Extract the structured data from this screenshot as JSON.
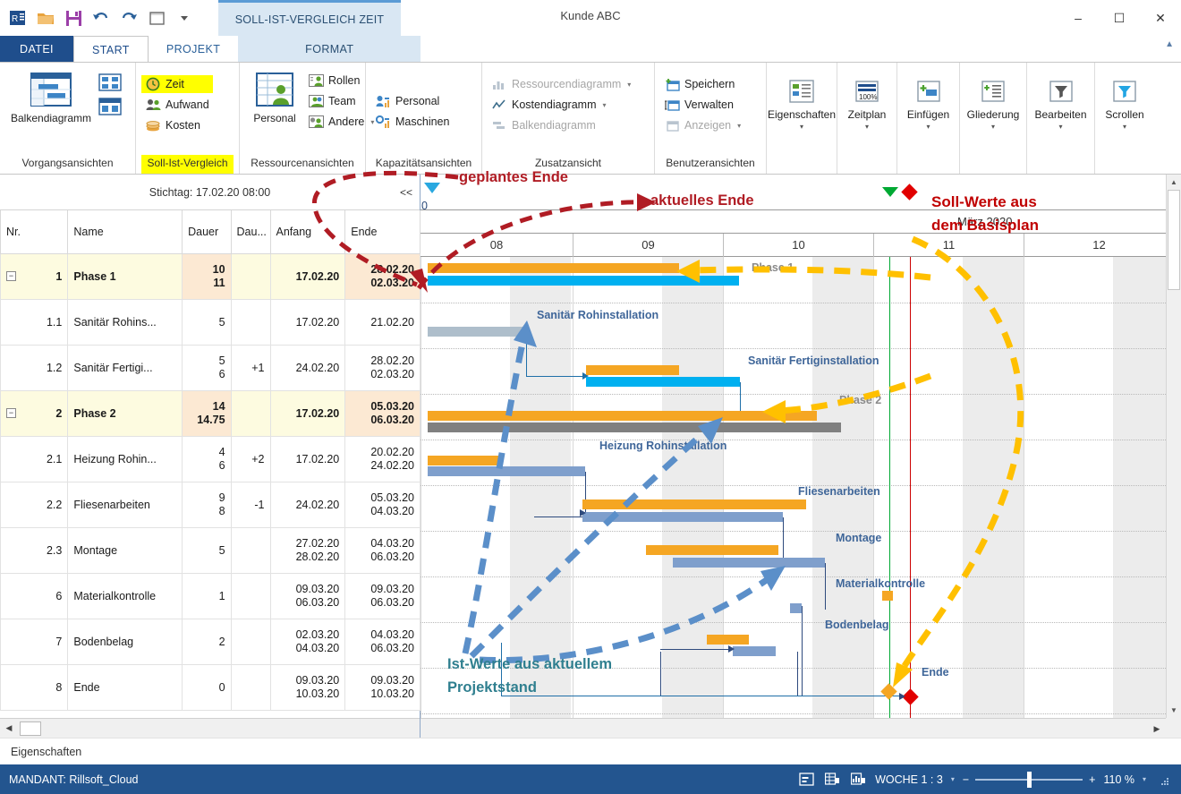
{
  "window": {
    "title": "Kunde ABC",
    "context_tab_banner": "SOLL-IST-VERGLEICH ZEIT",
    "minimize": "–",
    "maximize": "☐",
    "close": "✕",
    "qat_icons": [
      "app-logo-icon",
      "open-folder-icon",
      "save-icon",
      "undo-icon",
      "redo-icon",
      "new-window-icon",
      "customize-qat-icon"
    ]
  },
  "tabs": [
    {
      "label": "DATEI",
      "name": "tab-datei"
    },
    {
      "label": "START",
      "name": "tab-start"
    },
    {
      "label": "PROJEKT",
      "name": "tab-projekt"
    },
    {
      "label": "FORMAT",
      "name": "tab-format"
    }
  ],
  "ribbon": {
    "collapse_caret": "▲",
    "groups": [
      {
        "label": "Vorgangsansichten",
        "highlight": false,
        "big": {
          "label": "Balkendiagramm",
          "icon": "gantt-chart-icon"
        },
        "stack": [
          "network-diagram-icon",
          "table-view-icon"
        ]
      },
      {
        "label": "Soll-Ist-Vergleich",
        "highlight": true,
        "items": [
          {
            "label": "Zeit",
            "icon": "clock-icon",
            "highlight": true,
            "dim": false
          },
          {
            "label": "Aufwand",
            "icon": "people-icon",
            "highlight": false,
            "dim": false
          },
          {
            "label": "Kosten",
            "icon": "coins-icon",
            "highlight": false,
            "dim": false
          }
        ]
      },
      {
        "label": "Ressourcenansichten",
        "highlight": false,
        "big": {
          "label": "Personal",
          "icon": "resource-table-icon"
        },
        "items": [
          {
            "label": "Rollen",
            "icon": "roles-icon",
            "dim": false
          },
          {
            "label": "Team",
            "icon": "team-icon",
            "dim": false
          },
          {
            "label": "Andere",
            "icon": "other-icon",
            "dim": false,
            "caret": "▾"
          }
        ]
      },
      {
        "label": "Kapazitätsansichten",
        "highlight": false,
        "items": [
          {
            "label": "Personal",
            "icon": "staff-bars-icon",
            "dim": false
          },
          {
            "label": "Maschinen",
            "icon": "machine-bars-icon",
            "dim": false
          }
        ]
      },
      {
        "label": "Zusatzansicht",
        "highlight": false,
        "items": [
          {
            "label": "Ressourcendiagramm",
            "icon": "bar-chart-icon",
            "dim": true,
            "caret": "▾"
          },
          {
            "label": "Kostendiagramm",
            "icon": "line-chart-icon",
            "dim": false,
            "caret": "▾"
          },
          {
            "label": "Balkendiagramm",
            "icon": "gantt-small-icon",
            "dim": true
          }
        ]
      },
      {
        "label": "Benutzeransichten",
        "highlight": false,
        "items": [
          {
            "label": "Speichern",
            "icon": "save-view-icon",
            "dim": false
          },
          {
            "label": "Verwalten",
            "icon": "manage-view-icon",
            "dim": false
          },
          {
            "label": "Anzeigen",
            "icon": "show-view-icon",
            "dim": true,
            "caret": "▾"
          }
        ]
      }
    ],
    "right_buttons": [
      {
        "label": "Eigenschaften",
        "icon": "properties-icon",
        "arrow": "▾"
      },
      {
        "label": "Zeitplan",
        "icon": "schedule-100-icon",
        "arrow": "▾"
      },
      {
        "label": "Einfügen",
        "icon": "insert-icon",
        "arrow": "▾"
      },
      {
        "label": "Gliederung",
        "icon": "outline-icon",
        "arrow": "▾"
      },
      {
        "label": "Bearbeiten",
        "icon": "filter-icon",
        "arrow": "▾"
      },
      {
        "label": "Scrollen",
        "icon": "scroll-filter-icon",
        "arrow": "▾"
      }
    ]
  },
  "table": {
    "stichtag": "Stichtag: 17.02.20 08:00",
    "collapse_label": "<<",
    "columns": [
      "Nr.",
      "Name",
      "Dauer",
      "Dau...",
      "Anfang",
      "Ende"
    ],
    "rows": [
      {
        "nr": "1",
        "name": "Phase 1",
        "dauer": "10\n11",
        "dauer_diff": "",
        "anfang": "17.02.20",
        "ende": "28.02.20\n02.03.20",
        "phase": true,
        "expander": "−"
      },
      {
        "nr": "1.1",
        "name": "Sanitär Rohins...",
        "dauer": "5",
        "dauer_diff": "",
        "anfang": "17.02.20",
        "ende": "21.02.20",
        "phase": false,
        "expander": ""
      },
      {
        "nr": "1.2",
        "name": "Sanitär Fertigi...",
        "dauer": "5\n6",
        "dauer_diff": "+1",
        "anfang": "24.02.20",
        "ende": "28.02.20\n02.03.20",
        "phase": false,
        "expander": ""
      },
      {
        "nr": "2",
        "name": "Phase 2",
        "dauer": "14\n14.75",
        "dauer_diff": "",
        "anfang": "17.02.20",
        "ende": "05.03.20\n06.03.20",
        "phase": true,
        "expander": "−"
      },
      {
        "nr": "2.1",
        "name": "Heizung Rohin...",
        "dauer": "4\n6",
        "dauer_diff": "+2",
        "anfang": "17.02.20",
        "ende": "20.02.20\n24.02.20",
        "phase": false,
        "expander": ""
      },
      {
        "nr": "2.2",
        "name": "Fliesenarbeiten",
        "dauer": "9\n8",
        "dauer_diff": "-1",
        "anfang": "24.02.20",
        "ende": "05.03.20\n04.03.20",
        "phase": false,
        "expander": ""
      },
      {
        "nr": "2.3",
        "name": "Montage",
        "dauer": "5",
        "dauer_diff": "",
        "anfang": "27.02.20\n28.02.20",
        "ende": "04.03.20\n06.03.20",
        "phase": false,
        "expander": ""
      },
      {
        "nr": "6",
        "name": "Materialkontrolle",
        "dauer": "1",
        "dauer_diff": "",
        "anfang": "09.03.20\n06.03.20",
        "ende": "09.03.20\n06.03.20",
        "phase": false,
        "expander": ""
      },
      {
        "nr": "7",
        "name": "Bodenbelag",
        "dauer": "2",
        "dauer_diff": "",
        "anfang": "02.03.20\n04.03.20",
        "ende": "04.03.20\n06.03.20",
        "phase": false,
        "expander": ""
      },
      {
        "nr": "8",
        "name": "Ende",
        "dauer": "0",
        "dauer_diff": "",
        "anfang": "09.03.20\n10.03.20",
        "ende": "09.03.20\n10.03.20",
        "phase": false,
        "expander": ""
      }
    ]
  },
  "gantt": {
    "month_label": "März 2020",
    "week_ticks": [
      "08",
      "09",
      "10",
      "11",
      "12"
    ],
    "edge_tick": "0",
    "bar_labels": [
      "Phase 1",
      "Sanitär Rohinstallation",
      "Sanitär Fertiginstallation",
      "Phase 2",
      "Heizung Rohinstallation",
      "Fliesenarbeiten",
      "Montage",
      "Materialkontrolle",
      "Bodenbelag",
      "Ende"
    ],
    "markers": {
      "green_triangle": "today-marker-green",
      "red_diamond": "deadline-marker-red",
      "blue_triangle": "status-date-marker-blue"
    }
  },
  "annotations": [
    {
      "text": "geplantes Ende",
      "color": "#b01c24",
      "name": "annotation-geplantes-ende"
    },
    {
      "text": "aktuelles Ende",
      "color": "#b01c24",
      "name": "annotation-aktuelles-ende"
    },
    {
      "text": "Soll-Werte aus",
      "color": "#c00000",
      "name": "annotation-soll-werte-line1"
    },
    {
      "text": "dem Basisplan",
      "color": "#c00000",
      "name": "annotation-soll-werte-line2"
    },
    {
      "text": "Ist-Werte aus aktuellem",
      "color": "#2f7f8f",
      "name": "annotation-ist-werte-line1"
    },
    {
      "text": "Projektstand",
      "color": "#2f7f8f",
      "name": "annotation-ist-werte-line2"
    }
  ],
  "statusbar": {
    "properties_label": "Eigenschaften",
    "mandant": "MANDANT: Rillsoft_Cloud",
    "scale_label": "WOCHE 1 : 3",
    "scale_caret": "▾",
    "zoom_minus": "−",
    "zoom_plus": "+",
    "zoom_value": "110 %",
    "zoom_caret": "▾",
    "view_icons": [
      "split-view-icon",
      "table-view-icon",
      "chart-view-icon"
    ],
    "resize_grip": "resize-grip-icon"
  },
  "colors": {
    "plan_bar": "#f5a623",
    "actual_cyan": "#00b0f0",
    "actual_grey": "#808080",
    "actual_blue": "#7f9fcc",
    "accent_blue": "#1f4e8c",
    "highlight_yellow": "#ffff00",
    "annotation_red": "#b01c24",
    "annotation_teal": "#2f7f8f"
  }
}
